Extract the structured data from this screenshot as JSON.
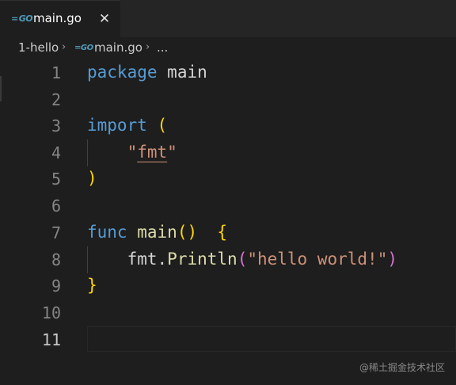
{
  "tab": {
    "icon_text": "GO",
    "label": "main.go",
    "close_symbol": "✕"
  },
  "breadcrumb": {
    "folder": "1-hello",
    "separator": "›",
    "file_icon_text": "GO",
    "file": "main.go",
    "more": "..."
  },
  "editor": {
    "line_numbers": [
      "1",
      "2",
      "3",
      "4",
      "5",
      "6",
      "7",
      "8",
      "9",
      "10",
      "11"
    ],
    "active_line": "11",
    "tokens": {
      "l1_kw": "package",
      "l1_name": "main",
      "l3_kw": "import",
      "l3_paren": "(",
      "l4_quote_open": "\"",
      "l4_pkg": "fmt",
      "l4_quote_close": "\"",
      "l5_paren": ")",
      "l7_kw": "func",
      "l7_name": "main",
      "l7_parens": "()",
      "l7_brace": "{",
      "l8_pkg": "fmt",
      "l8_dot": ".",
      "l8_fn": "Println",
      "l8_paren_open": "(",
      "l8_string": "\"hello world!\"",
      "l8_paren_close": ")",
      "l9_brace": "}"
    }
  },
  "watermark": "@稀土掘金技术社区",
  "colors": {
    "background": "#1e1e1e",
    "keyword": "#569cd6",
    "function": "#dcdcaa",
    "string": "#ce9178",
    "bracket": "#ffd700",
    "go_icon": "#519aba"
  }
}
